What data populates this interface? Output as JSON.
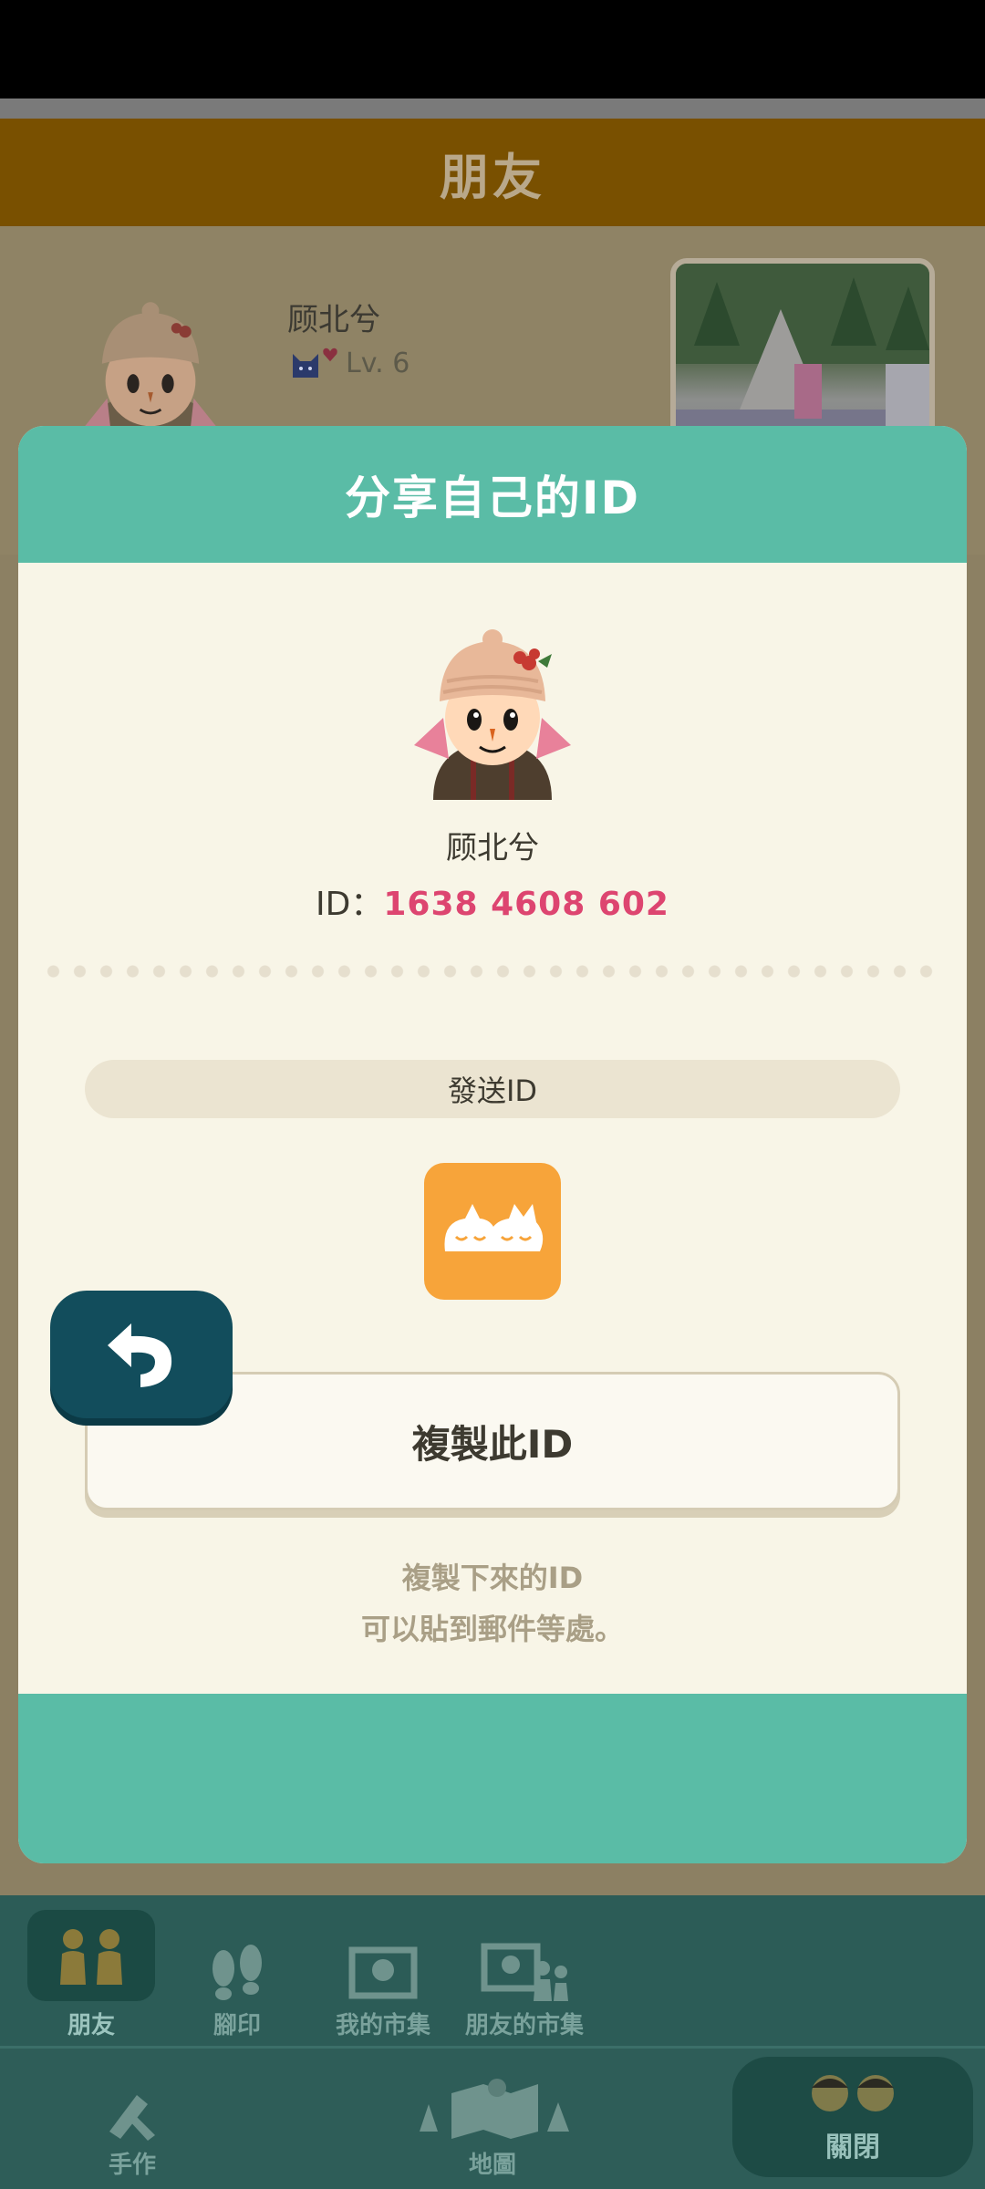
{
  "background": {
    "title": "朋友",
    "profile_name": "顾北兮",
    "profile_level": "Lv. 6"
  },
  "modal": {
    "title": "分享自己的ID",
    "player_name": "顾北兮",
    "id_label": "ID：",
    "id_value": "1638 4608 602",
    "send_label": "發送ID",
    "copy_button": "複製此ID",
    "hint_line1": "複製下來的ID",
    "hint_line2": "可以貼到郵件等處。"
  },
  "nav": {
    "friends": "朋友",
    "footprints": "腳印",
    "my_market": "我的市集",
    "friends_market": "朋友的市集",
    "crafting": "手作",
    "map": "地圖",
    "close": "關閉"
  },
  "colors": {
    "teal": "#5abca6",
    "id_pink": "#dd4570",
    "app_orange": "#f7a43a",
    "back_button": "#124d5c"
  },
  "icons": [
    "back-arrow-icon",
    "line-app-icon",
    "friends-icon",
    "footprint-icon",
    "market-icon",
    "friends-market-icon",
    "craft-icon",
    "map-icon",
    "close-friends-icon",
    "cat-icon",
    "heart-icon"
  ]
}
